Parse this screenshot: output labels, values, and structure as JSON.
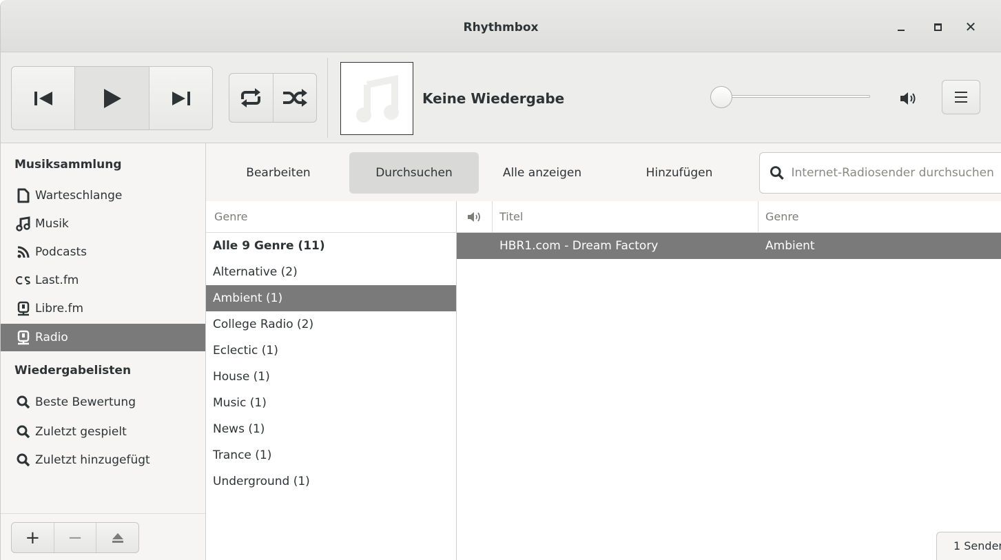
{
  "window": {
    "title": "Rhythmbox"
  },
  "toolbar": {
    "now_playing": "Keine Wiedergabe",
    "volume_level": 0
  },
  "sidebar": {
    "library_header": "Musiksammlung",
    "library_items": [
      {
        "label": "Warteschlange",
        "icon": "queue-icon"
      },
      {
        "label": "Musik",
        "icon": "music-icon"
      },
      {
        "label": "Podcasts",
        "icon": "rss-icon"
      },
      {
        "label": "Last.fm",
        "icon": "lastfm-icon"
      },
      {
        "label": "Libre.fm",
        "icon": "radio-icon"
      },
      {
        "label": "Radio",
        "icon": "radio-icon",
        "selected": true
      }
    ],
    "playlists_header": "Wiedergabelisten",
    "playlist_items": [
      {
        "label": "Beste Bewertung",
        "icon": "search-icon"
      },
      {
        "label": "Zuletzt gespielt",
        "icon": "search-icon"
      },
      {
        "label": "Zuletzt hinzugefügt",
        "icon": "search-icon"
      }
    ]
  },
  "source_toolbar": {
    "edit": "Bearbeiten",
    "browse": "Durchsuchen",
    "show_all": "Alle anzeigen",
    "add": "Hinzufügen",
    "search_placeholder": "Internet-Radiosender durchsuchen"
  },
  "genre_pane": {
    "header": "Genre",
    "items": [
      {
        "label": "Alle 9 Genre (11)",
        "bold": true
      },
      {
        "label": "Alternative (2)"
      },
      {
        "label": "Ambient (1)",
        "selected": true
      },
      {
        "label": "College Radio (2)"
      },
      {
        "label": "Eclectic (1)"
      },
      {
        "label": "House (1)"
      },
      {
        "label": "Music (1)"
      },
      {
        "label": "News (1)"
      },
      {
        "label": "Trance (1)"
      },
      {
        "label": "Underground (1)"
      }
    ]
  },
  "station_pane": {
    "columns": {
      "title": "Titel",
      "genre": "Genre"
    },
    "rows": [
      {
        "title": "HBR1.com - Dream Factory",
        "genre": "Ambient",
        "selected": true
      }
    ]
  },
  "status": {
    "text": "1 Sender"
  }
}
